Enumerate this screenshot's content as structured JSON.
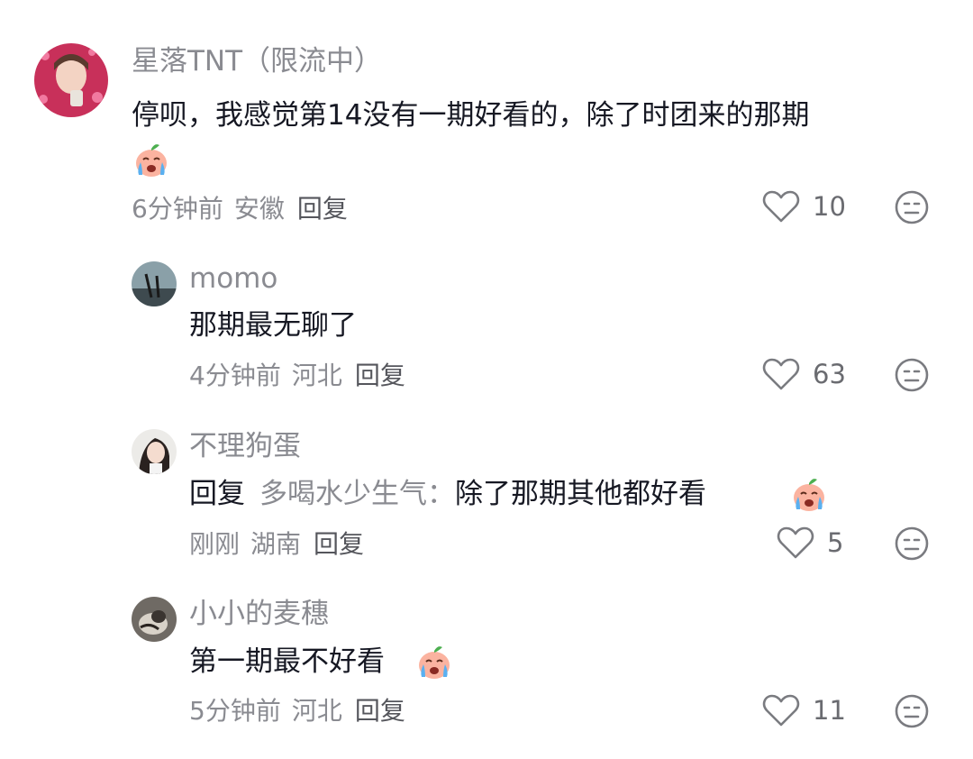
{
  "comments": [
    {
      "username": "星落TNT（限流中）",
      "text": "停呗，我感觉第14没有一期好看的，除了时团来的那期",
      "time": "6分钟前",
      "location": "安徽",
      "reply_label": "回复",
      "likes": "10"
    },
    {
      "username": "momo",
      "text": "那期最无聊了",
      "time": "4分钟前",
      "location": "河北",
      "reply_label": "回复",
      "likes": "63"
    },
    {
      "username": "不理狗蛋",
      "reply_prefix": "回复",
      "reply_to": "多喝水少生气：",
      "text": "除了那期其他都好看",
      "time": "刚刚",
      "location": "湖南",
      "reply_label": "回复",
      "likes": "5"
    },
    {
      "username": "小小的麦穗",
      "text": "第一期最不好看",
      "time": "5分钟前",
      "location": "河北",
      "reply_label": "回复",
      "likes": "11"
    }
  ],
  "icons": {
    "like": "heart-outline-icon",
    "dislike": "neutral-face-icon",
    "emoji": "crying-peach-emoji"
  },
  "colors": {
    "username": "#8a8b91",
    "text": "#161823",
    "meta": "#8a8b91",
    "icon": "#7a7b80"
  }
}
